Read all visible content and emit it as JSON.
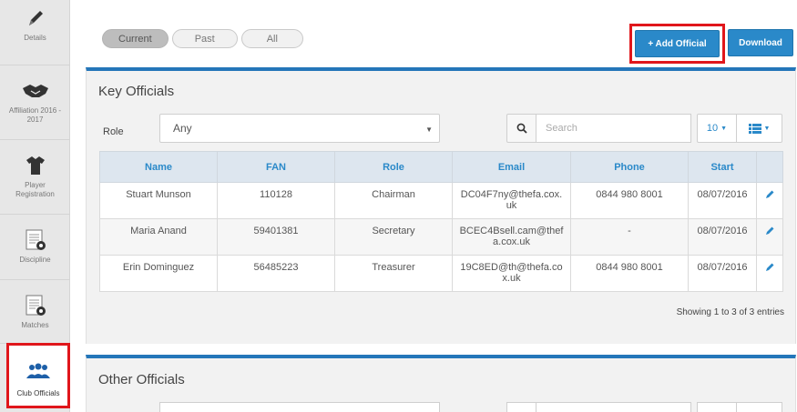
{
  "sidebar": {
    "items": [
      {
        "label": "Details",
        "icon": "pencil-icon"
      },
      {
        "label": "Affiliation 2016 - 2017",
        "icon": "handshake-icon"
      },
      {
        "label": "Player Registration",
        "icon": "shirt-icon"
      },
      {
        "label": "Discipline",
        "icon": "document-ball-icon"
      },
      {
        "label": "Matches",
        "icon": "document-ball-icon"
      },
      {
        "label": "Club Officials",
        "icon": "people-icon"
      }
    ]
  },
  "filters": {
    "tabs": [
      "Current",
      "Past",
      "All"
    ],
    "active": "Current"
  },
  "toolbar": {
    "add_label": "+ Add Official",
    "download_label": "Download"
  },
  "key_officials": {
    "title": "Key Officials",
    "role_label": "Role",
    "role_value": "Any",
    "search_placeholder": "Search",
    "per_page": "10",
    "columns": [
      "Name",
      "FAN",
      "Role",
      "Email",
      "Phone",
      "Start"
    ],
    "rows": [
      {
        "name": "Stuart Munson",
        "fan": "110128",
        "role": "Chairman",
        "email": "DC04F7ny@thefa.cox.uk",
        "phone": "0844 980 8001",
        "start": "08/07/2016"
      },
      {
        "name": "Maria Anand",
        "fan": "59401381",
        "role": "Secretary",
        "email": "BCEC4Bsell.cam@thefa.cox.uk",
        "phone": "-",
        "start": "08/07/2016"
      },
      {
        "name": "Erin Dominguez",
        "fan": "56485223",
        "role": "Treasurer",
        "email": "19C8ED@th@thefa.cox.uk",
        "phone": "0844 980 8001",
        "start": "08/07/2016"
      }
    ],
    "showing_text": "Showing 1 to 3 of 3 entries"
  },
  "other_officials": {
    "title": "Other Officials"
  },
  "colors": {
    "accent": "#2a89c9",
    "panel_border": "#2476b9",
    "highlight": "#e0161b"
  }
}
